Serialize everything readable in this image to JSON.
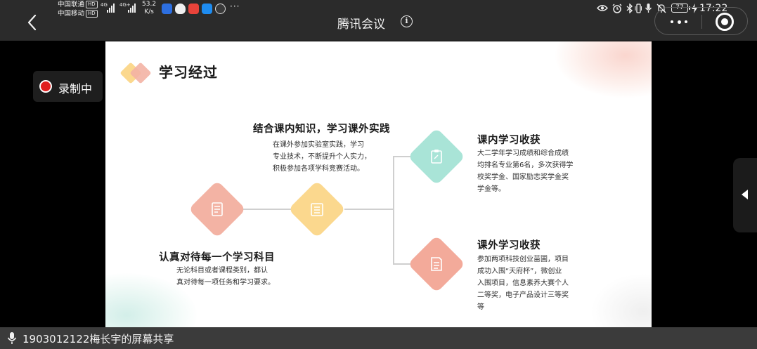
{
  "status_bar": {
    "carrier_1": "中国联通",
    "carrier_2": "中国移动",
    "hd_badge": "HD",
    "network_1": "4G",
    "network_2": "4G+",
    "speed_value": "53.2",
    "speed_unit": "K/s",
    "more": "···",
    "battery": "77",
    "time": "17:22"
  },
  "header": {
    "title": "腾讯会议"
  },
  "recording": {
    "label": "录制中"
  },
  "slide": {
    "title": "学习经过",
    "steps": [
      {
        "heading": "认真对待每一个学习科目",
        "lines": [
          "无论科目或者课程类别，都认",
          "真对待每一项任务和学习要求。"
        ],
        "icon": "document-icon",
        "color": "#f3b3a4"
      },
      {
        "heading": "结合课内知识，学习课外实践",
        "lines": [
          "在课外参加实验室实践，学习",
          "专业技术，不断提升个人实力，",
          "积极参加各项学科竞赛活动。"
        ],
        "icon": "list-icon",
        "color": "#fbd88e"
      }
    ],
    "outcomes": [
      {
        "heading": "课内学习收获",
        "lines": [
          "大二学年学习成绩和综合成绩",
          "均排名专业第6名，多次获得学",
          "校奖学金、国家励志奖学金奖",
          "学金等。"
        ],
        "icon": "clipboard-icon",
        "color": "#a9e4d7"
      },
      {
        "heading": "课外学习收获",
        "lines": [
          "参加两项科技创业苗圃，项目",
          "成功入围“天府杯”，微创业",
          "入围项目，信息素养大赛个人",
          "二等奖，电子产品设计三等奖",
          "等"
        ],
        "icon": "note-icon",
        "color": "#f3aa9a"
      }
    ]
  },
  "share_bar": {
    "label": "1903012122梅长宇的屏幕共享"
  }
}
